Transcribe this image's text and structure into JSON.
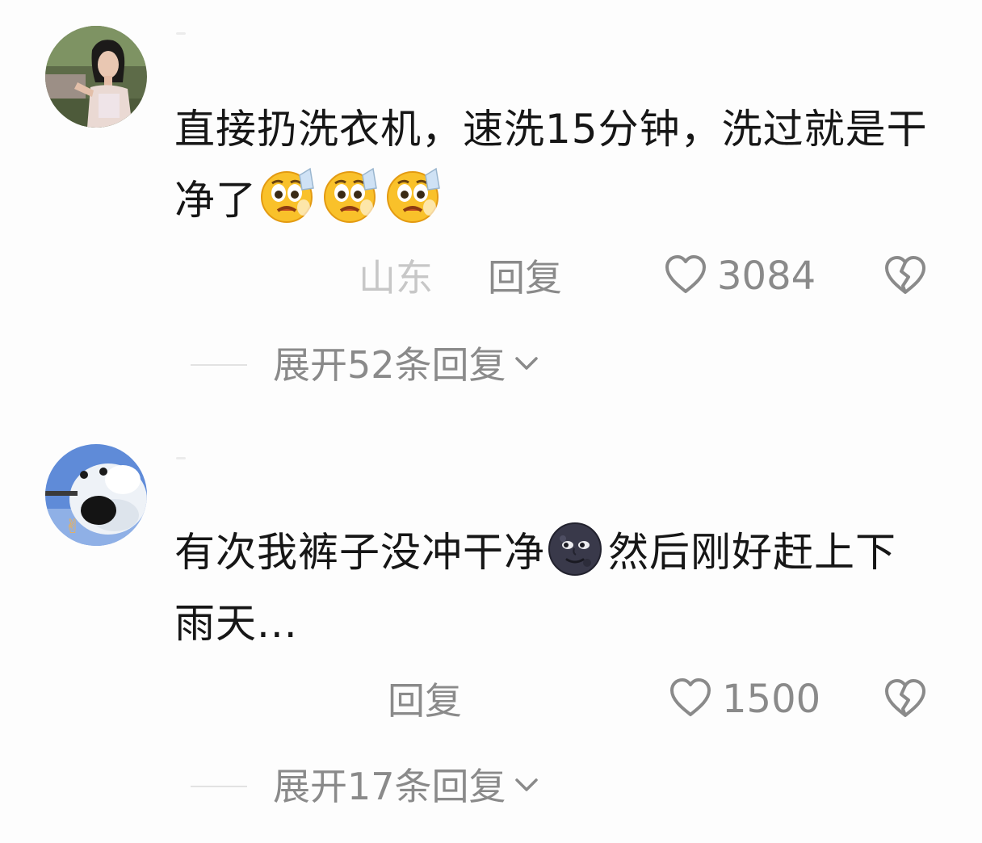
{
  "comments": [
    {
      "avatar": "avatar-photo-girl",
      "text_parts": [
        "直接扔洗衣机，速洗15分钟，洗过就是干净了"
      ],
      "emoji": [
        "face-holding-back-tears-emoji",
        "face-holding-back-tears-emoji",
        "face-holding-back-tears-emoji"
      ],
      "region": "山东",
      "reply_label": "回复",
      "like_icon": "heart-outline-icon",
      "like_count": "3084",
      "dislike_icon": "broken-heart-icon",
      "expand_label": "展开52条回复",
      "expand_icon": "chevron-down-icon"
    },
    {
      "avatar": "avatar-seal",
      "text_before": "有次我裤子没冲干净",
      "emoji": [
        "new-moon-face-emoji"
      ],
      "text_after": "然后刚好赶上下雨天...",
      "reply_label": "回复",
      "like_icon": "heart-outline-icon",
      "like_count": "1500",
      "dislike_icon": "broken-heart-icon",
      "expand_label": "展开17条回复",
      "expand_icon": "chevron-down-icon"
    }
  ]
}
